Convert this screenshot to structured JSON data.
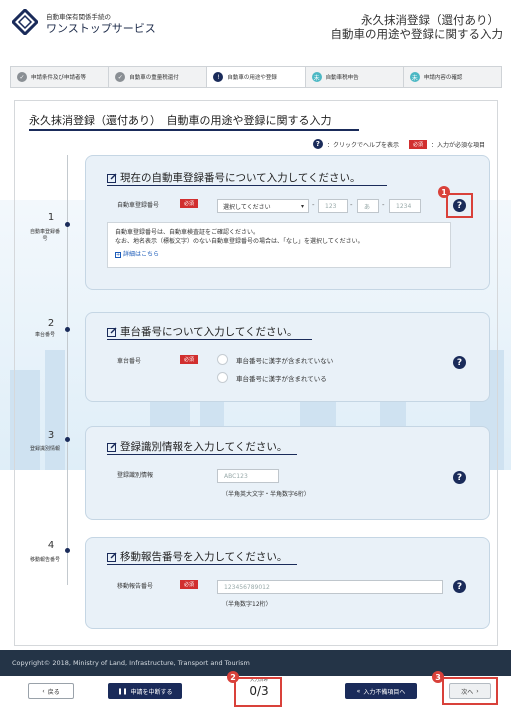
{
  "header": {
    "logo_sub": "自動車保有関係手続の",
    "logo_main": "ワンストップサービス",
    "title_line1": "永久抹消登録（還付あり）",
    "title_line2": "自動車の用途や登録に関する入力"
  },
  "steps": [
    {
      "label": "申請条件及び申請者等",
      "state": "done",
      "dot": "✓"
    },
    {
      "label": "自動車の重量税還付",
      "state": "done",
      "dot": "✓"
    },
    {
      "label": "自動車の用途や登録",
      "state": "current",
      "dot": "!"
    },
    {
      "label": "自動車税申告",
      "state": "todo",
      "dot": "未"
    },
    {
      "label": "申請内容の確認",
      "state": "todo",
      "dot": "未"
    }
  ],
  "panel": {
    "title": "永久抹消登録（還付あり）　自動車の用途や登録に関する入力",
    "legend_help": "：クリックでヘルプを表示",
    "legend_required": "必須",
    "legend_required_text": "：入力が必須な項目"
  },
  "timeline": [
    {
      "num": "1",
      "label": "自動車登録番号"
    },
    {
      "num": "2",
      "label": "車台番号"
    },
    {
      "num": "3",
      "label": "登録識別情報"
    },
    {
      "num": "4",
      "label": "移動報告番号"
    }
  ],
  "section1": {
    "heading": "現在の自動車登録番号について入力してください。",
    "field_label": "自動車登録番号",
    "required": "必須",
    "select_value": "選択してください",
    "input2_placeholder": "123",
    "input3_placeholder": "あ",
    "input4_placeholder": "1234",
    "info_line1": "自動車登録番号は、自動車検査証をご確認ください。",
    "info_line2": "なお、地名表示（標板文字）のない自動車登録番号の場合は、「なし」を選択してください。",
    "detail_link": "詳細はこちら"
  },
  "section2": {
    "heading": "車台番号について入力してください。",
    "field_label": "車台番号",
    "required": "必須",
    "option1": "車台番号に漢字が含まれていない",
    "option2": "車台番号に漢字が含まれている"
  },
  "section3": {
    "heading": "登録識別情報を入力してください。",
    "field_label": "登録識別情報",
    "placeholder": "ABC123",
    "hint": "（半角英大文字・半角数字6桁）"
  },
  "section4": {
    "heading": "移動報告番号を入力してください。",
    "field_label": "移動報告番号",
    "required": "必須",
    "placeholder": "123456789012",
    "hint": "（半角数字12桁）"
  },
  "annotations": [
    "1",
    "2",
    "3"
  ],
  "footer": {
    "copyright": "Copyright© 2018, Ministry of Land, Infrastructure, Transport and Tourism"
  },
  "bottom": {
    "back": "戻る",
    "suspend": "申請を中断する",
    "counter_label": "入力済み",
    "counter_value": "0/3",
    "missing": "入力不備項目へ",
    "next": "次へ"
  },
  "colors": {
    "navy": "#1a2b5a",
    "required_red": "#d12f2f",
    "highlight_red": "#d9413a",
    "card_bg": "#e9f1f8",
    "footer_bg": "#243447"
  }
}
